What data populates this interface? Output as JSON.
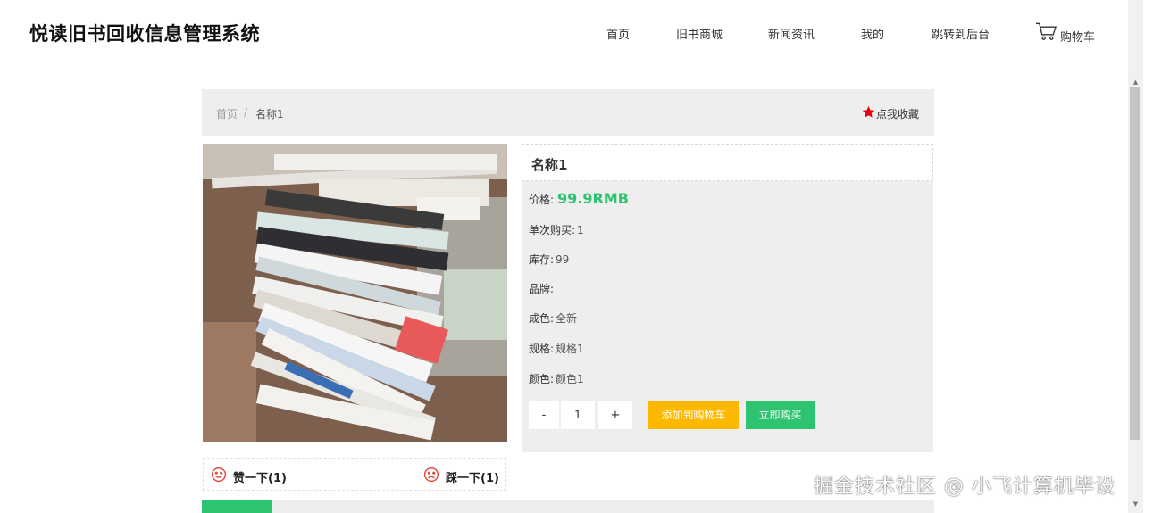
{
  "header": {
    "site_title": "悦读旧书回收信息管理系统",
    "nav": [
      "首页",
      "旧书商城",
      "新闻资讯",
      "我的",
      "跳转到后台"
    ],
    "cart_label": "购物车"
  },
  "breadcrumb": {
    "home": "首页",
    "separator": "/",
    "current": "名称1"
  },
  "favorite_label": "点我收藏",
  "product": {
    "name": "名称1",
    "price_label": "价格:",
    "price": "99.9RMB",
    "per_purchase_label": "单次购买:",
    "per_purchase": "1",
    "stock_label": "库存:",
    "stock": "99",
    "brand_label": "品牌:",
    "brand": "",
    "condition_label": "成色:",
    "condition": "全新",
    "spec_label": "规格:",
    "spec": "规格1",
    "color_label": "颜色:",
    "color": "颜色1"
  },
  "quantity": {
    "minus": "-",
    "value": "1",
    "plus": "+"
  },
  "buttons": {
    "add_to_cart": "添加到购物车",
    "buy_now": "立即购买"
  },
  "votes": {
    "like": "赞一下(1)",
    "dislike": "踩一下(1)"
  },
  "watermark": "掘金技术社区 @ 小飞计算机毕设",
  "colors": {
    "accent_green": "#2ec370",
    "cart_button": "#ffb800",
    "favorite_star": "#e60012",
    "vote_icon": "#e8483f",
    "panel_gray": "#eeeeee"
  },
  "icons": [
    "cart-icon",
    "star-icon",
    "smile-icon",
    "frown-icon"
  ]
}
